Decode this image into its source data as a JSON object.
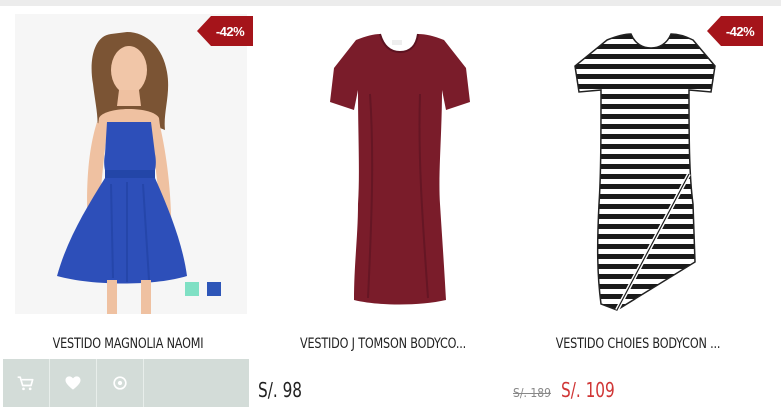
{
  "products": [
    {
      "name": "VESTIDO MAGNOLIA NAOMI",
      "badge": "-42%",
      "swatch_colors": [
        "#7fe0c4",
        "#2e56b8"
      ],
      "dress_color": "#2d4fb9",
      "actions": [
        "cart-icon",
        "heart-icon",
        "view-icon"
      ]
    },
    {
      "name": "VESTIDO J TOMSON BODYCO...",
      "price": "S/. 98",
      "dress_color": "#7a1c2a"
    },
    {
      "name": "VESTIDO CHOIES BODYCON ...",
      "badge": "-42%",
      "old_price": "S/. 189",
      "price": "S/. 109",
      "dress_color": "#1a1a1a"
    }
  ],
  "colors": {
    "badge": "#a5141a",
    "sale_price": "#d03636",
    "action_bar": "#d3dcd8"
  }
}
